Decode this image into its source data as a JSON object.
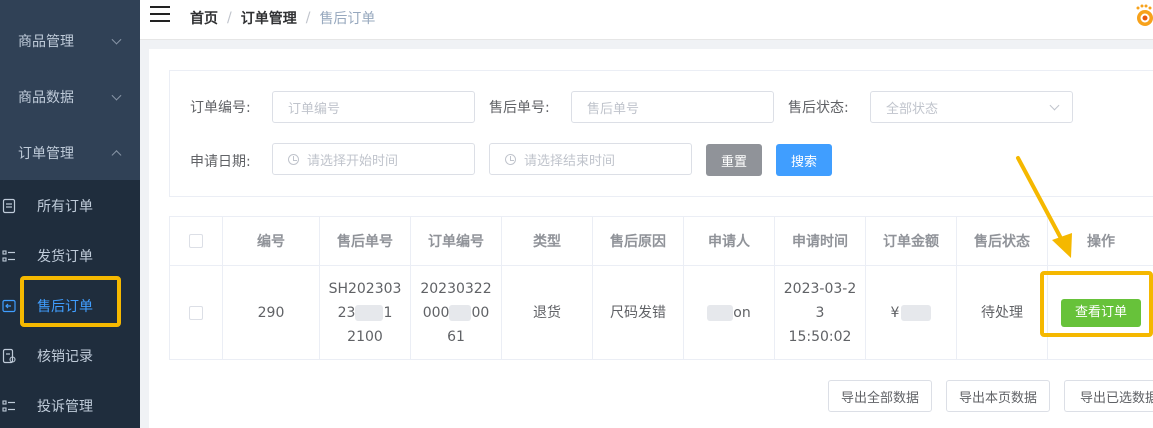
{
  "sidebar": {
    "menus": [
      {
        "label": "商品管理"
      },
      {
        "label": "商品数据"
      },
      {
        "label": "订单管理"
      }
    ],
    "submenu": [
      {
        "label": "所有订单",
        "icon": "document-icon"
      },
      {
        "label": "发货订单",
        "icon": "list-icon"
      },
      {
        "label": "售后订单",
        "icon": "return-icon"
      },
      {
        "label": "核销记录",
        "icon": "record-icon"
      },
      {
        "label": "投诉管理",
        "icon": "list-icon"
      }
    ]
  },
  "header": {
    "breadcrumb": [
      "首页",
      "订单管理",
      "售后订单"
    ],
    "separator": "/"
  },
  "filter": {
    "order_no_label": "订单编号:",
    "order_no_placeholder": "订单编号",
    "after_no_label": "售后单号:",
    "after_no_placeholder": "售后单号",
    "status_label": "售后状态:",
    "status_value": "全部状态",
    "date_label": "申请日期:",
    "start_placeholder": "请选择开始时间",
    "end_placeholder": "请选择结束时间",
    "reset_label": "重置",
    "search_label": "搜索"
  },
  "table": {
    "headers": [
      "编号",
      "售后单号",
      "订单编号",
      "类型",
      "售后原因",
      "申请人",
      "申请时间",
      "订单金额",
      "售后状态",
      "操作"
    ],
    "rows": [
      {
        "id": "290",
        "after_no_1": "SH202303",
        "after_no_2a": "23",
        "after_no_2b": "1",
        "after_no_3": "2100",
        "order_no_1": "20230322",
        "order_no_2a": "000",
        "order_no_2b": "00",
        "order_no_3": "61",
        "type": "退货",
        "reason": "尺码发错",
        "applicant_suffix": "on",
        "time_1": "2023-03-2",
        "time_2": "3 15:50:02",
        "amount_prefix": "¥",
        "status": "待处理",
        "action_label": "查看订单"
      }
    ]
  },
  "export": {
    "all": "导出全部数据",
    "page": "导出本页数据",
    "selected": "导出已选数据"
  },
  "colors": {
    "sidebar_bg": "#304156",
    "submenu_bg": "#1f2d3d",
    "active": "#409eff",
    "highlight": "#f5b800",
    "success": "#67c23a"
  }
}
